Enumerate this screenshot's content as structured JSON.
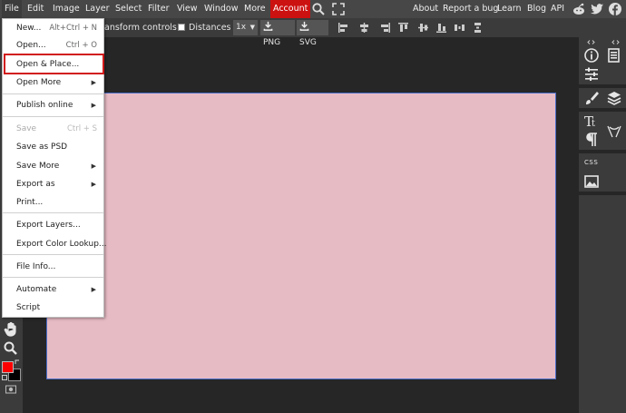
{
  "menubar": {
    "items": [
      "File",
      "Edit",
      "Image",
      "Layer",
      "Select",
      "Filter",
      "View",
      "Window",
      "More",
      "Account"
    ],
    "right_links": [
      "About",
      "Report a bug",
      "Learn",
      "Blog",
      "API"
    ]
  },
  "options": {
    "transform_label": "ansform controls",
    "distances_label": "Distances",
    "zoom_value": "1x",
    "png_label": "PNG",
    "svg_label": "SVG"
  },
  "file_menu": {
    "items": [
      {
        "label": "New...",
        "shortcut": "Alt+Ctrl + N"
      },
      {
        "label": "Open...",
        "shortcut": "Ctrl + O"
      },
      {
        "label": "Open & Place..."
      },
      {
        "label": "Open More",
        "submenu": true
      },
      {
        "label": "Publish online",
        "submenu": true
      },
      {
        "label": "Save",
        "shortcut": "Ctrl + S",
        "disabled": true
      },
      {
        "label": "Save as PSD"
      },
      {
        "label": "Save More",
        "submenu": true
      },
      {
        "label": "Export as",
        "submenu": true
      },
      {
        "label": "Print..."
      },
      {
        "label": "Export Layers..."
      },
      {
        "label": "Export Color Lookup..."
      },
      {
        "label": "File Info..."
      },
      {
        "label": "Automate",
        "submenu": true
      },
      {
        "label": "Script"
      }
    ]
  },
  "right_panel": {
    "css_label": "CSS"
  },
  "colors": {
    "foreground": "#ff0000",
    "background": "#000000",
    "canvas": "#e7bbc4",
    "accent": "#cc1111"
  }
}
